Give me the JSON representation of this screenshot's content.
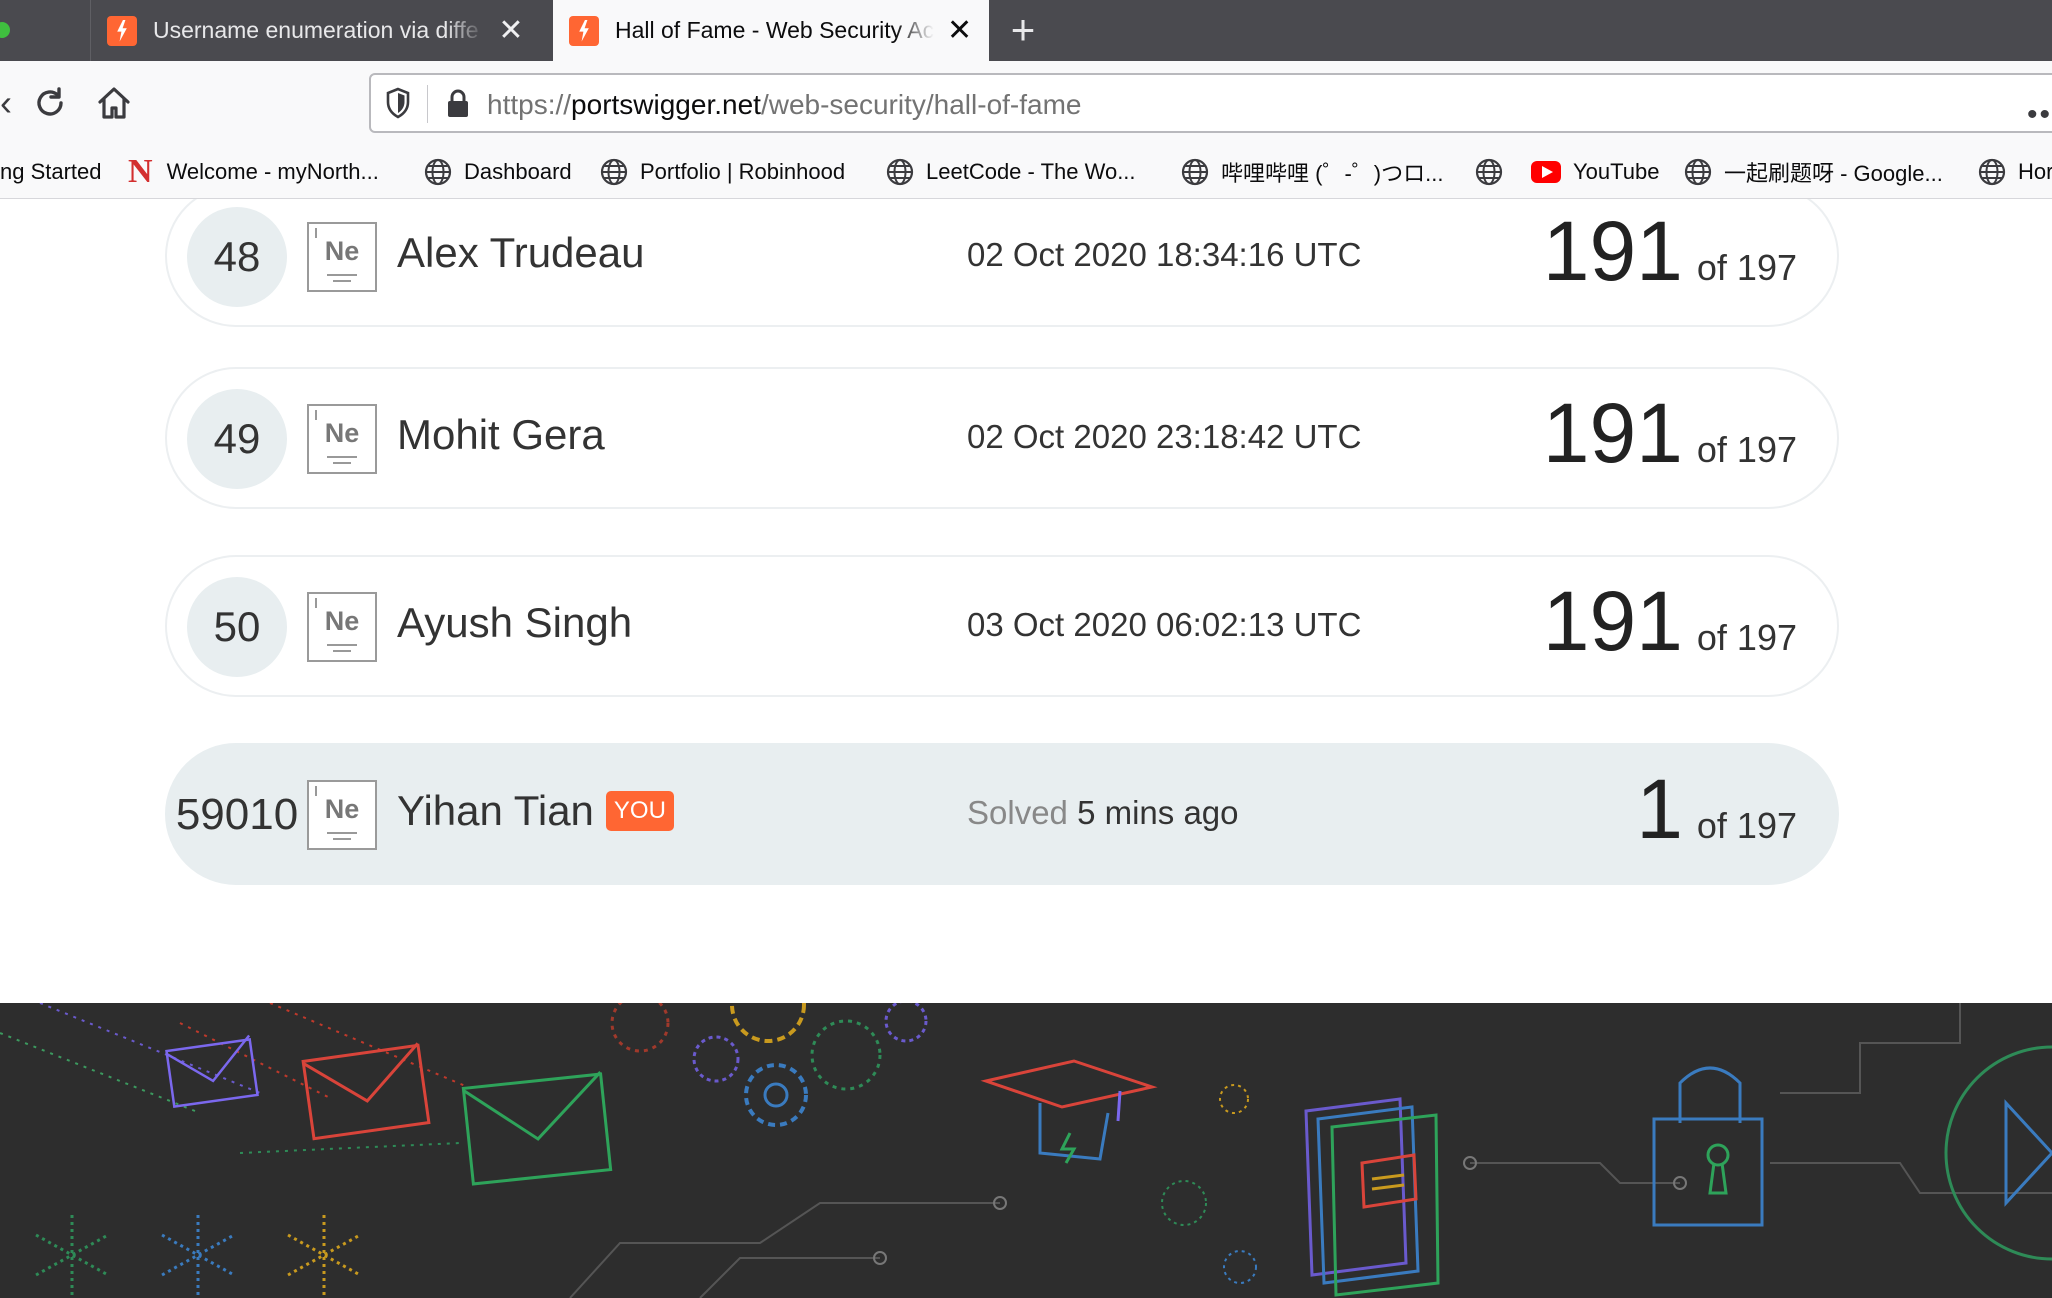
{
  "browser": {
    "tabs": [
      {
        "title": "Username enumeration via diffe",
        "active": false
      },
      {
        "title": "Hall of Fame - Web Security Ac",
        "active": true
      }
    ],
    "url": {
      "scheme": "https://",
      "host": "portswigger.net",
      "path": "/web-security/hall-of-fame"
    },
    "bookmarks": [
      {
        "label": "ng Started",
        "icon": "none"
      },
      {
        "label": "Welcome - myNorth...",
        "icon": "n-logo-icon"
      },
      {
        "label": "Dashboard",
        "icon": "globe-icon"
      },
      {
        "label": "Portfolio | Robinhood",
        "icon": "globe-icon"
      },
      {
        "label": "LeetCode - The Wo...",
        "icon": "globe-icon"
      },
      {
        "label": "哔哩哔哩 (゜-゜)つロ...",
        "icon": "globe-icon"
      },
      {
        "label": "",
        "icon": "globe-icon"
      },
      {
        "label": "YouTube",
        "icon": "youtube-icon"
      },
      {
        "label": "一起刷题呀 - Google...",
        "icon": "globe-icon"
      },
      {
        "label": "Hor",
        "icon": "globe-icon"
      }
    ]
  },
  "leaderboard": {
    "rows": [
      {
        "rank": "48",
        "element": "Ne",
        "name": "Alex Trudeau",
        "time": "02 Oct 2020 18:34:16 UTC",
        "score": "191",
        "of": "of 197"
      },
      {
        "rank": "49",
        "element": "Ne",
        "name": "Mohit Gera",
        "time": "02 Oct 2020 23:18:42 UTC",
        "score": "191",
        "of": "of 197"
      },
      {
        "rank": "50",
        "element": "Ne",
        "name": "Ayush Singh",
        "time": "03 Oct 2020 06:02:13 UTC",
        "score": "191",
        "of": "of 197"
      }
    ],
    "me": {
      "rank": "59010",
      "element": "Ne",
      "name": "Yihan Tian",
      "badge": "YOU",
      "solved_label": "Solved",
      "solved_time": "5 mins ago",
      "score": "1",
      "of": "of 197"
    }
  },
  "colors": {
    "accent": "#ff6633",
    "row_highlight": "#e8eef0",
    "footer_bg": "#2d2d2d"
  }
}
